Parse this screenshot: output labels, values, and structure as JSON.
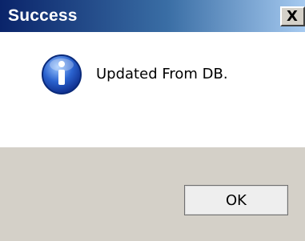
{
  "window": {
    "title": "Success",
    "close_glyph": "X"
  },
  "dialog": {
    "icon": "information-icon",
    "message": "Updated From DB."
  },
  "buttons": {
    "ok_label": "OK"
  },
  "colors": {
    "titlebar_start": "#0a246a",
    "titlebar_end": "#a6caf0",
    "footer_bg": "#d4d0c8",
    "content_bg": "#ffffff"
  }
}
